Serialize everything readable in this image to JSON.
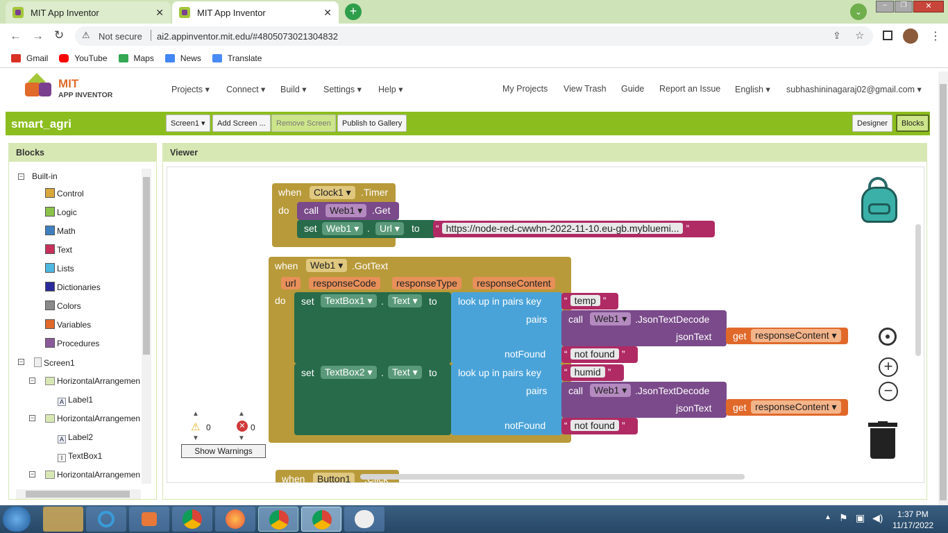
{
  "browser": {
    "tabs": [
      {
        "title": "MIT App Inventor"
      },
      {
        "title": "MIT App Inventor"
      }
    ],
    "new_tab": "+",
    "security": "Not secure",
    "url": "ai2.appinventor.mit.edu/#4805073021304832",
    "bookmarks": [
      "Gmail",
      "YouTube",
      "Maps",
      "News",
      "Translate"
    ]
  },
  "header": {
    "logo_line1": "MIT",
    "logo_line2": "APP INVENTOR",
    "menus": [
      "Projects",
      "Connect",
      "Build",
      "Settings",
      "Help"
    ],
    "links": [
      "My Projects",
      "View Trash",
      "Guide",
      "Report an Issue"
    ],
    "language": "English",
    "account": "subhashininagaraj02@gmail.com"
  },
  "project": {
    "name": "smart_agri",
    "screen_select": "Screen1",
    "add_screen": "Add Screen ...",
    "remove_screen": "Remove Screen",
    "publish": "Publish to Gallery",
    "designer": "Designer",
    "blocks": "Blocks"
  },
  "blocks_panel": {
    "title": "Blocks",
    "builtin": "Built-in",
    "categories": [
      {
        "label": "Control",
        "color": "#d8a83a"
      },
      {
        "label": "Logic",
        "color": "#8bc34a"
      },
      {
        "label": "Math",
        "color": "#3f7fc0"
      },
      {
        "label": "Text",
        "color": "#c8305c"
      },
      {
        "label": "Lists",
        "color": "#4fb8e0"
      },
      {
        "label": "Dictionaries",
        "color": "#2a2a9c"
      },
      {
        "label": "Colors",
        "color": "#8a8a8a"
      },
      {
        "label": "Variables",
        "color": "#e0692a"
      },
      {
        "label": "Procedures",
        "color": "#8a5a9a"
      }
    ],
    "screen": "Screen1",
    "components": [
      "HorizontalArrangemen",
      "Label1",
      "HorizontalArrangemen",
      "Label2",
      "TextBox1",
      "HorizontalArrangemen"
    ]
  },
  "viewer": {
    "title": "Viewer",
    "warnings_count": "0",
    "errors_count": "0",
    "show_warnings": "Show Warnings"
  },
  "code": {
    "when": "when",
    "do": "do",
    "set": "set",
    "call": "call",
    "to": "to",
    "get": "get",
    "dot": ".",
    "clock": "Clock1",
    "timer": ".Timer",
    "web": "Web1",
    "get_method": ".Get",
    "url_prop": "Url",
    "url_value": "https://node-red-cwwhn-2022-11-10.eu-gb.mybluemi...",
    "gottext": ".GotText",
    "params": [
      "url",
      "responseCode",
      "responseType",
      "responseContent"
    ],
    "textbox1": "TextBox1",
    "textbox2": "TextBox2",
    "text_prop": "Text",
    "lookup": "look up in pairs  key",
    "key1": "temp",
    "key2": "humid",
    "pairs": "pairs",
    "jsondecode": ".JsonTextDecode",
    "jsontext": "jsonText",
    "response_content": "responseContent",
    "notfound": "notFound",
    "notfound_value": "not found",
    "button": "Button1",
    "click": ".Click"
  },
  "taskbar": {
    "time": "1:37 PM",
    "date": "11/17/2022"
  }
}
